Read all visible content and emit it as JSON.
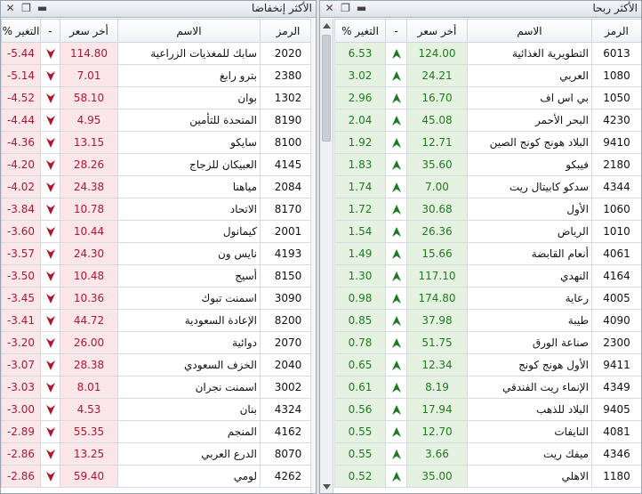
{
  "gainers": {
    "title": "الأكثر ربحا",
    "headers": {
      "code": "الرمز",
      "name": "الاسم",
      "price": "أخر سعر",
      "dir": "-",
      "change": "التغير %"
    },
    "rows": [
      {
        "code": "6013",
        "name": "التطويرية الغذائية",
        "price": "124.00",
        "change": "6.53"
      },
      {
        "code": "1080",
        "name": "العربي",
        "price": "24.21",
        "change": "3.02"
      },
      {
        "code": "1050",
        "name": "بي اس اف",
        "price": "16.70",
        "change": "2.96"
      },
      {
        "code": "4230",
        "name": "البحر الأحمر",
        "price": "45.08",
        "change": "2.04"
      },
      {
        "code": "9410",
        "name": "البلاد هونج كونج الصين",
        "price": "12.71",
        "change": "1.92"
      },
      {
        "code": "2180",
        "name": "فيبكو",
        "price": "35.60",
        "change": "1.83"
      },
      {
        "code": "4344",
        "name": "سدكو كابيتال ريت",
        "price": "7.00",
        "change": "1.74"
      },
      {
        "code": "1060",
        "name": "الأول",
        "price": "30.68",
        "change": "1.72"
      },
      {
        "code": "1010",
        "name": "الرياض",
        "price": "26.36",
        "change": "1.54"
      },
      {
        "code": "4061",
        "name": "أنعام القابضة",
        "price": "15.66",
        "change": "1.49"
      },
      {
        "code": "4164",
        "name": "النهدي",
        "price": "117.10",
        "change": "1.30"
      },
      {
        "code": "4005",
        "name": "رعاية",
        "price": "174.80",
        "change": "0.98"
      },
      {
        "code": "4090",
        "name": "طيبة",
        "price": "37.98",
        "change": "0.85"
      },
      {
        "code": "2300",
        "name": "صناعة الورق",
        "price": "51.75",
        "change": "0.78"
      },
      {
        "code": "9411",
        "name": "الأول هونج كونج",
        "price": "12.34",
        "change": "0.65"
      },
      {
        "code": "4349",
        "name": "الإنماء ريت الفندقي",
        "price": "8.19",
        "change": "0.61"
      },
      {
        "code": "9405",
        "name": "البلاد للذهب",
        "price": "17.94",
        "change": "0.56"
      },
      {
        "code": "4081",
        "name": "النايفات",
        "price": "12.70",
        "change": "0.55"
      },
      {
        "code": "4346",
        "name": "ميفك ريت",
        "price": "3.66",
        "change": "0.55"
      },
      {
        "code": "1180",
        "name": "الاهلي",
        "price": "35.00",
        "change": "0.52"
      }
    ]
  },
  "losers": {
    "title": "الأكثر إنخفاضا",
    "headers": {
      "code": "الرمز",
      "name": "الاسم",
      "price": "أخر سعر",
      "dir": "-",
      "change": "التغير %"
    },
    "rows": [
      {
        "code": "2020",
        "name": "سابك للمغذيات الزراعية",
        "price": "114.80",
        "change": "-5.44"
      },
      {
        "code": "2380",
        "name": "بترو رابغ",
        "price": "7.01",
        "change": "-5.14"
      },
      {
        "code": "1302",
        "name": "بوان",
        "price": "58.10",
        "change": "-4.52"
      },
      {
        "code": "8190",
        "name": "المتحدة للتأمين",
        "price": "4.95",
        "change": "-4.44"
      },
      {
        "code": "8100",
        "name": "سايكو",
        "price": "13.15",
        "change": "-4.36"
      },
      {
        "code": "4145",
        "name": "العبيكان للزجاج",
        "price": "28.26",
        "change": "-4.20"
      },
      {
        "code": "2084",
        "name": "مياهنا",
        "price": "24.38",
        "change": "-4.02"
      },
      {
        "code": "8170",
        "name": "الاتحاد",
        "price": "10.78",
        "change": "-3.84"
      },
      {
        "code": "2001",
        "name": "كيمانول",
        "price": "10.44",
        "change": "-3.60"
      },
      {
        "code": "4193",
        "name": "نايس ون",
        "price": "24.30",
        "change": "-3.57"
      },
      {
        "code": "8150",
        "name": "أسيج",
        "price": "10.48",
        "change": "-3.50"
      },
      {
        "code": "3090",
        "name": "اسمنت تبوك",
        "price": "10.36",
        "change": "-3.45"
      },
      {
        "code": "8200",
        "name": "الإعادة السعودية",
        "price": "44.72",
        "change": "-3.41"
      },
      {
        "code": "2070",
        "name": "دوائية",
        "price": "26.00",
        "change": "-3.20"
      },
      {
        "code": "2040",
        "name": "الخزف السعودي",
        "price": "28.38",
        "change": "-3.07"
      },
      {
        "code": "3002",
        "name": "اسمنت نجران",
        "price": "8.01",
        "change": "-3.03"
      },
      {
        "code": "4324",
        "name": "بنان",
        "price": "4.53",
        "change": "-3.00"
      },
      {
        "code": "4162",
        "name": "المنجم",
        "price": "55.35",
        "change": "-2.89"
      },
      {
        "code": "8070",
        "name": "الدرع العربي",
        "price": "13.25",
        "change": "-2.86"
      },
      {
        "code": "4262",
        "name": "لومي",
        "price": "59.40",
        "change": "-2.86"
      }
    ]
  },
  "colors": {
    "gain": "#1e7a1e",
    "gain_bg": "#e6f2e1",
    "loss": "#b01530",
    "loss_bg": "#fbe7ea"
  },
  "icons": {
    "gain_arrow": "up-arrow-icon",
    "loss_arrow": "down-arrow-icon",
    "minimize": "minimize-icon",
    "restore": "restore-icon",
    "close": "close-icon"
  }
}
